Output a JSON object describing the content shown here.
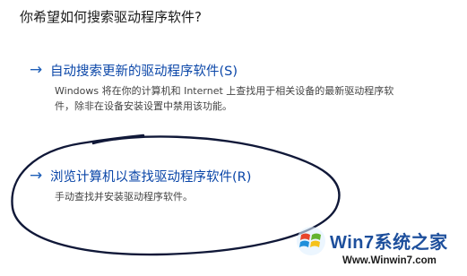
{
  "question": "你希望如何搜索驱动程序软件?",
  "options": [
    {
      "icon": "arrow-right-icon",
      "title": "自动搜索更新的驱动程序软件(S)",
      "desc_line1": "Windows 将在你的计算机和 Internet 上查找用于相关设备的最新驱动程序软",
      "desc_line2": "件，除非在设备安装设置中禁用该功能。"
    },
    {
      "icon": "arrow-right-icon",
      "title": "浏览计算机以查找驱动程序软件(R)",
      "desc_line1": "手动查找并安装驱动程序软件。"
    }
  ],
  "watermark": {
    "brand": "Win7系统之家",
    "url": "Www.Winwin7.com"
  },
  "colors": {
    "link": "#0a46a8",
    "annotation_ink": "#101838",
    "watermark_blue": "#1d4f9c"
  }
}
